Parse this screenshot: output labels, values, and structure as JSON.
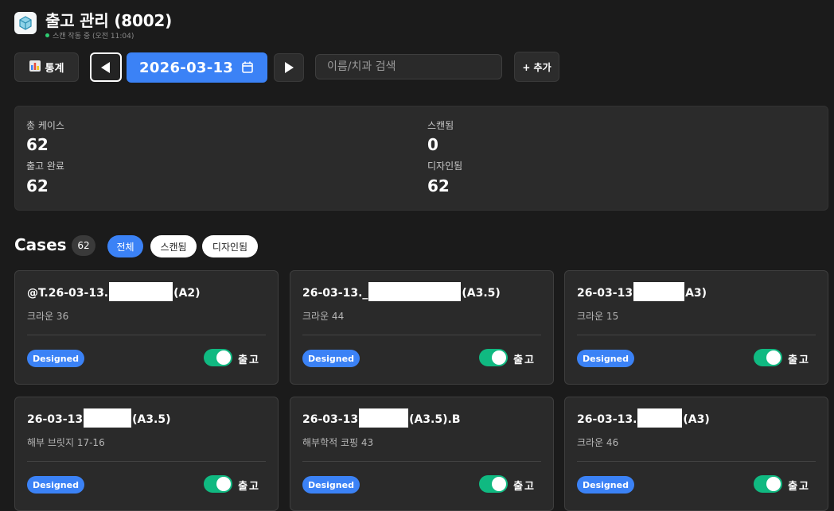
{
  "header": {
    "title": "출고 관리 (8002)",
    "status_text": "스캔 작동 중 (오전 11:04)",
    "status_color": "#2ecc71"
  },
  "toolbar": {
    "stats_label": "통계",
    "prev_icon": "triangle-left-icon",
    "date": "2026-03-13",
    "calendar_icon": "calendar-icon",
    "next_icon": "triangle-right-icon",
    "search_placeholder": "이름/치과 검색",
    "search_value": "",
    "add_label": "+ 추가"
  },
  "summary": {
    "total_label": "총 케이스",
    "total_value": "62",
    "scanned_label": "스캔됨",
    "scanned_value": "0",
    "released_label": "출고 완료",
    "released_value": "62",
    "designed_label": "디자인됨",
    "designed_value": "62"
  },
  "cases_section": {
    "title": "Cases",
    "count": "62",
    "filters": [
      "전체",
      "스캔됨",
      "디자인됨"
    ],
    "active_filter": "전체"
  },
  "cards": [
    {
      "title_prefix": "@T.26-03-13.",
      "title_suffix": "(A2)",
      "subtitle": "크라운 36",
      "badge": "Designed",
      "toggle_on": true,
      "toggle_label": "출고"
    },
    {
      "title_prefix": "26-03-13._",
      "title_suffix": "(A3.5)",
      "subtitle": "크라운 44",
      "badge": "Designed",
      "toggle_on": true,
      "toggle_label": "출고"
    },
    {
      "title_prefix": "26-03-13",
      "title_suffix": "A3)",
      "subtitle": "크라운 15",
      "badge": "Designed",
      "toggle_on": true,
      "toggle_label": "출고"
    },
    {
      "title_prefix": "26-03-13",
      "title_suffix": "(A3.5)",
      "subtitle": "해부 브릿지 17-16",
      "badge": "Designed",
      "toggle_on": true,
      "toggle_label": "출고"
    },
    {
      "title_prefix": "26-03-13",
      "title_suffix": "(A3.5).B",
      "subtitle": "해부학적 코핑 43",
      "badge": "Designed",
      "toggle_on": true,
      "toggle_label": "출고"
    },
    {
      "title_prefix": "26-03-13.",
      "title_suffix": "(A3)",
      "subtitle": "크라운 46",
      "badge": "Designed",
      "toggle_on": true,
      "toggle_label": "출고"
    }
  ],
  "colors": {
    "accent": "#3b82f6",
    "toggle_on": "#10b981",
    "background": "#1b1b1b",
    "panel": "#2a2a2a"
  }
}
